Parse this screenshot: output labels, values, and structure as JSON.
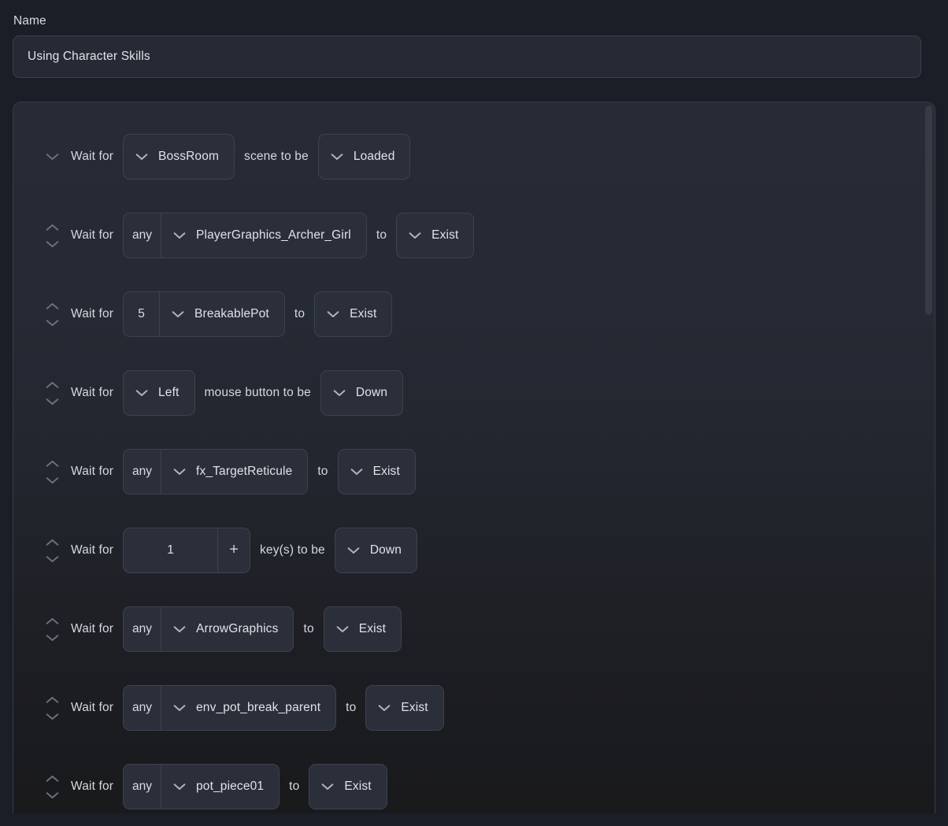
{
  "name_field": {
    "label": "Name",
    "value": "Using Character Skills",
    "placeholder": "Name"
  },
  "icons": {
    "chevron_up": "chevron-up-icon",
    "chevron_down": "chevron-down-icon",
    "plus": "plus-icon"
  },
  "colors": {
    "page_background": "#1b1e27",
    "panel_top": "#272b36",
    "panel_bottom": "#191a1c",
    "control_fill": "#2b2f3a",
    "control_border": "#3d424f",
    "text_primary": "#e0e3e9",
    "text_secondary": "#d5d8df",
    "chevron_muted": "#6d7382",
    "scrollbar_thumb": "#373b46"
  },
  "steps": [
    {
      "lead": "Wait for",
      "has_up_chevron": false,
      "has_down_chevron": true,
      "count": null,
      "target": "BossRoom",
      "connector": "scene to be",
      "state": "Loaded",
      "kind": "scene"
    },
    {
      "lead": "Wait for",
      "has_up_chevron": true,
      "has_down_chevron": true,
      "count": "any",
      "target": "PlayerGraphics_Archer_Girl",
      "connector": "to",
      "state": "Exist",
      "kind": "object"
    },
    {
      "lead": "Wait for",
      "has_up_chevron": true,
      "has_down_chevron": true,
      "count": "5",
      "target": "BreakablePot",
      "connector": "to",
      "state": "Exist",
      "kind": "object"
    },
    {
      "lead": "Wait for",
      "has_up_chevron": true,
      "has_down_chevron": true,
      "count": null,
      "target": "Left",
      "connector": "mouse button to be",
      "state": "Down",
      "kind": "mouse"
    },
    {
      "lead": "Wait for",
      "has_up_chevron": true,
      "has_down_chevron": true,
      "count": "any",
      "target": "fx_TargetReticule",
      "connector": "to",
      "state": "Exist",
      "kind": "object"
    },
    {
      "lead": "Wait for",
      "has_up_chevron": true,
      "has_down_chevron": true,
      "count": null,
      "key_value": "1",
      "plus_label": "+",
      "connector": "key(s) to be",
      "state": "Down",
      "kind": "key"
    },
    {
      "lead": "Wait for",
      "has_up_chevron": true,
      "has_down_chevron": true,
      "count": "any",
      "target": "ArrowGraphics",
      "connector": "to",
      "state": "Exist",
      "kind": "object"
    },
    {
      "lead": "Wait for",
      "has_up_chevron": true,
      "has_down_chevron": true,
      "count": "any",
      "target": "env_pot_break_parent",
      "connector": "to",
      "state": "Exist",
      "kind": "object"
    },
    {
      "lead": "Wait for",
      "has_up_chevron": true,
      "has_down_chevron": true,
      "count": "any",
      "target": "pot_piece01",
      "connector": "to",
      "state": "Exist",
      "kind": "object"
    }
  ]
}
